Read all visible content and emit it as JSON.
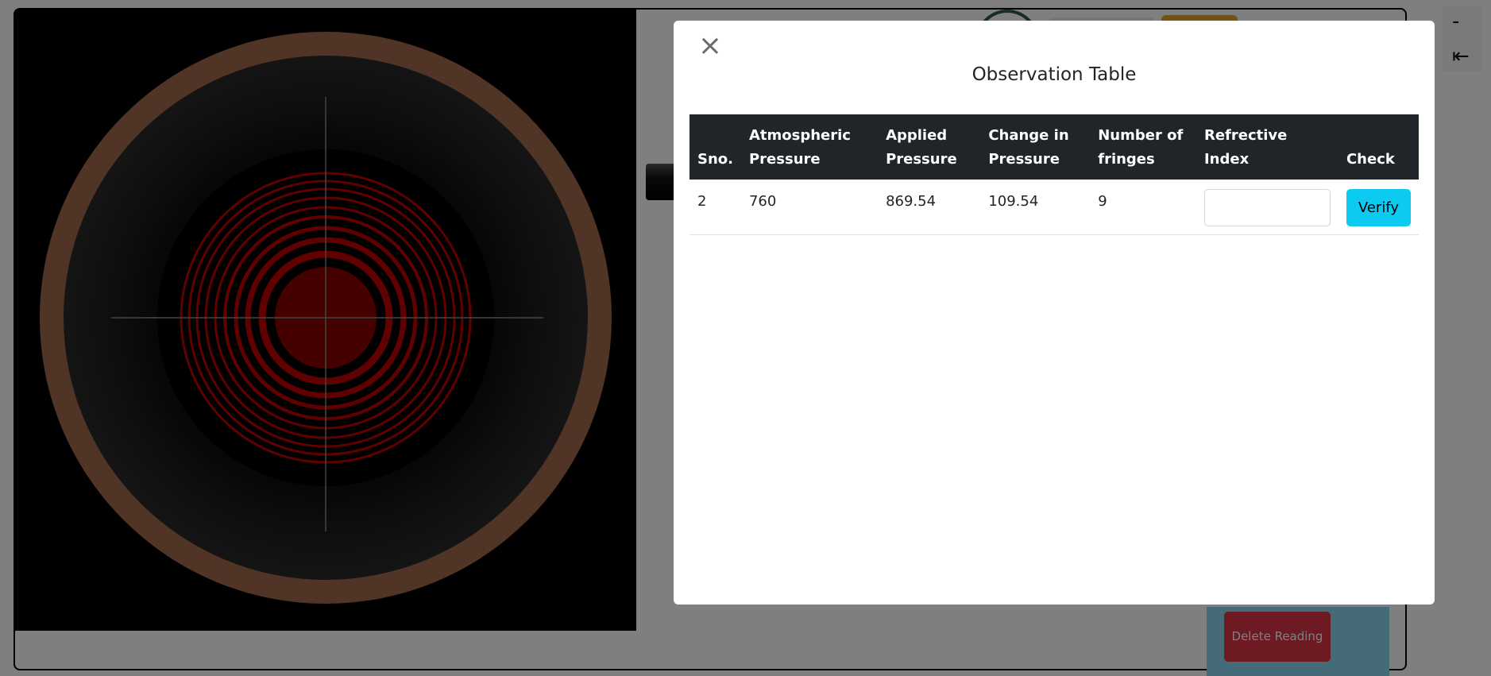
{
  "app": {
    "delete_button_label": "Delete Reading",
    "side_icon_top": "-",
    "side_icon_bottom": "⇤"
  },
  "modal": {
    "title": "Observation Table",
    "close_glyph": "×"
  },
  "table": {
    "headers": [
      "Sno.",
      "Atmospheric Pressure",
      "Applied Pressure",
      "Change in Pressure",
      "Number of fringes",
      "Refrective Index",
      "Check"
    ],
    "rows": [
      {
        "sno": "2",
        "atmospheric_pressure": "760",
        "applied_pressure": "869.54",
        "change_in_pressure": "109.54",
        "number_of_fringes": "9",
        "refractive_index_value": "",
        "check_label": "Verify"
      }
    ]
  },
  "colors": {
    "accent": "#0dcaf0",
    "danger": "#dc3545",
    "table_header": "#212529",
    "fringe": "#c00000",
    "fringe_center": "#8b0000",
    "eyepiece_rim": "#a0694a"
  },
  "icons": {
    "close": "close-icon",
    "exit": "exit-arrow-icon"
  }
}
